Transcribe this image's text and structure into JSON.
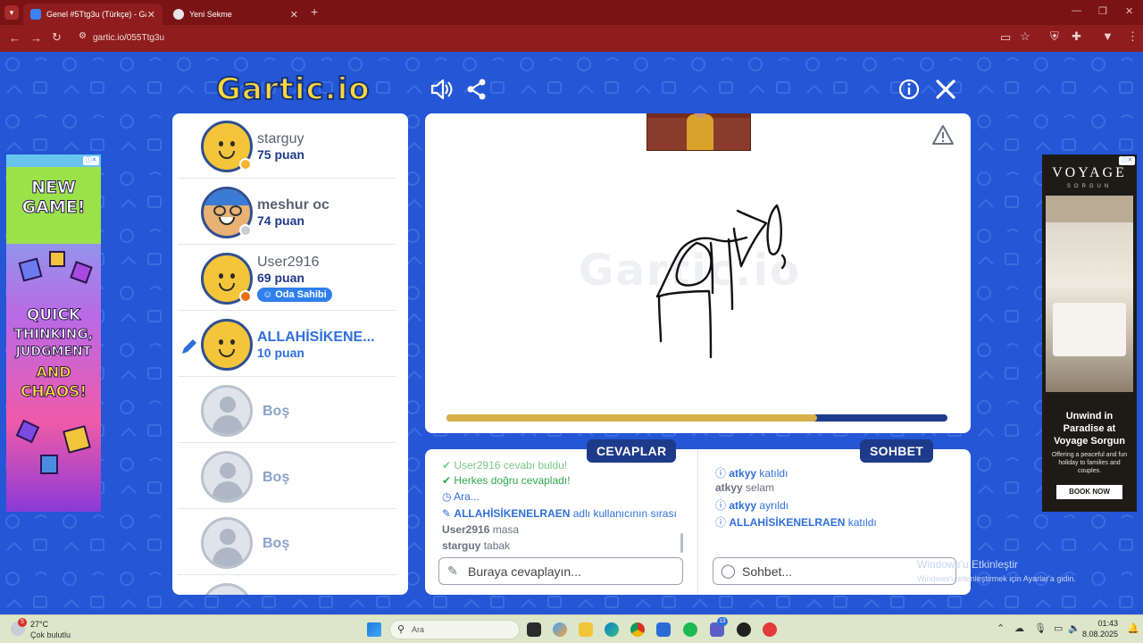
{
  "browser": {
    "tabs": [
      {
        "title": "Genel #5Ttg3u (Türkçe) - Gartic"
      },
      {
        "title": "Yeni Sekme"
      }
    ],
    "new_tab": "+",
    "url": "gartic.io/055Ttg3u"
  },
  "game": {
    "logo": "Gartic.io",
    "players": [
      {
        "name": "starguy",
        "points": "75 puan",
        "status_color": "#f2b632"
      },
      {
        "name": "meshur oc",
        "points": "74 puan",
        "status_color": "#c9ced6"
      },
      {
        "name": "User2916",
        "points": "69 puan",
        "status_color": "#e6731b",
        "badge": "Oda Sahibi"
      },
      {
        "name": "ALLAHİSİKENE...",
        "points": "10 puan",
        "drawing": true
      }
    ],
    "empty_slots": [
      "Boş",
      "Boş",
      "Boş"
    ],
    "canvas": {
      "watermark": "Gartic.io",
      "progress": 0.74,
      "progress_color": "#d8b04a"
    },
    "answers": {
      "title": "CEVAPLAR",
      "messages": [
        {
          "text": "User2916 cevabı buldu!",
          "color": "green",
          "icon": "check"
        },
        {
          "text": "Herkes doğru cevapladı!",
          "color": "green",
          "icon": "check"
        },
        {
          "text": "Ara...",
          "color": "blue",
          "icon": "clock"
        },
        {
          "bold": "ALLAHİSİKENELRAEN",
          "text": " adlı kullanıcının sırası",
          "color": "blue",
          "icon": "pencil"
        },
        {
          "bold": "User2916",
          "text": " masa",
          "color": "grey"
        },
        {
          "bold": "starguy",
          "text": " tabak",
          "color": "grey"
        }
      ],
      "placeholder": "Buraya cevaplayın..."
    },
    "chat": {
      "title": "SOHBET",
      "messages": [
        {
          "bold": "atkyy",
          "text": " katıldı",
          "color": "blue",
          "icon": "info"
        },
        {
          "bold": "atkyy",
          "text": " selam",
          "color": "grey"
        },
        {
          "bold": "atkyy",
          "text": " ayrıldı",
          "color": "blue",
          "icon": "info"
        },
        {
          "bold": "ALLAHİSİKENELRAEN",
          "text": " katıldı",
          "color": "blue",
          "icon": "info"
        }
      ],
      "placeholder": "Sohbet..."
    }
  },
  "ads": {
    "left": {
      "lines": [
        "NEW",
        "GAME!",
        "QUICK",
        "THINKING,",
        "JUDGMENT",
        "AND",
        "CHAOS!"
      ]
    },
    "right": {
      "brand": "VOYAGE",
      "brand_sub": "SORGUN",
      "headline": "Unwind in Paradise at Voyage Sorgun",
      "body": "Offering a peaceful and fun holiday to families and couples.",
      "cta": "BOOK NOW"
    }
  },
  "windows_activation": {
    "title": "Windows'u Etkinleştir",
    "subtitle": "Windows'u etkinleştirmek için Ayarlar'a gidin."
  },
  "taskbar": {
    "weather_temp": "27°C",
    "weather_desc": "Çok bulutlu",
    "weather_badge": "5",
    "search": "Ara",
    "time": "01:43",
    "date": "8.08.2025",
    "teams_badge": "13"
  }
}
